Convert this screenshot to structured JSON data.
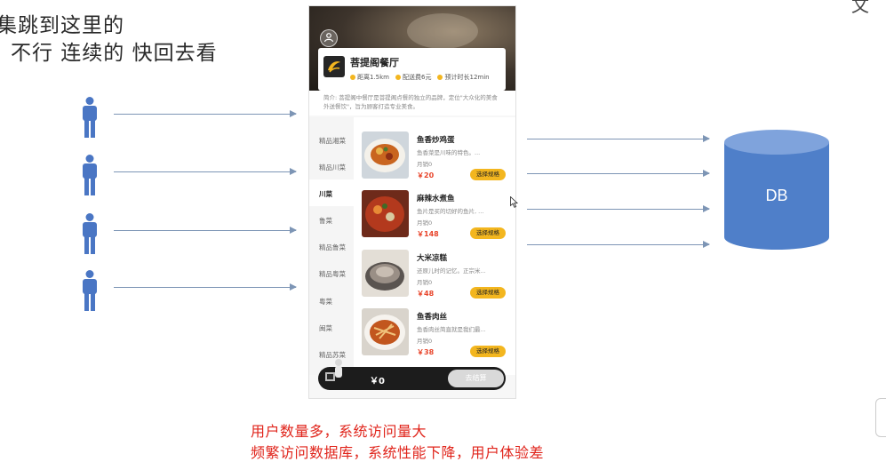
{
  "captions": {
    "line1": "集跳到这里的",
    "line2": "不行 连续的 快回去看",
    "corner": "文"
  },
  "shop": {
    "name": "菩提阁餐厅",
    "distance": "距离1.5km",
    "delivery_fee": "配送费6元",
    "eta": "预计时长12min",
    "description": "简介: 菩提阁中餐厅是菩提阁点餐的独立的品牌，定位\"大众化的美食外送餐饮\"，旨为顾客打造专业美食。"
  },
  "categories": [
    "精品湘菜",
    "精品川菜",
    "川菜",
    "鲁菜",
    "精品鲁菜",
    "精品粤菜",
    "粤菜",
    "闽菜",
    "精品苏菜"
  ],
  "active_category": "川菜",
  "dishes": [
    {
      "name": "鱼香炒鸡蛋",
      "desc": "鱼香菜是川味的特色。...",
      "sold": "月销0",
      "price": "￥20",
      "button": "选择规格"
    },
    {
      "name": "麻辣水煮鱼",
      "desc": "鱼片是买的切好的鱼片, ...",
      "sold": "月销0",
      "price": "￥148",
      "button": "选择规格"
    },
    {
      "name": "大米凉糕",
      "desc": "还原儿时的记忆。正宗米...",
      "sold": "月销0",
      "price": "￥48",
      "button": "选择规格"
    },
    {
      "name": "鱼香肉丝",
      "desc": "鱼香肉丝简直就是我们最...",
      "sold": "月销0",
      "price": "￥38",
      "button": "选择规格"
    }
  ],
  "cart": {
    "total": "￥0",
    "checkout": "去结算"
  },
  "db_label": "DB",
  "footer": {
    "line1": "用户数量多，系统访问量大",
    "line2": "频繁访问数据库，系统性能下降，用户体验差"
  },
  "colors": {
    "person": "#4a76c4",
    "db": "#4f7fc9",
    "arrow": "#7d95b5",
    "footer_text": "#e0241b",
    "accent_yellow": "#f3b61f"
  }
}
